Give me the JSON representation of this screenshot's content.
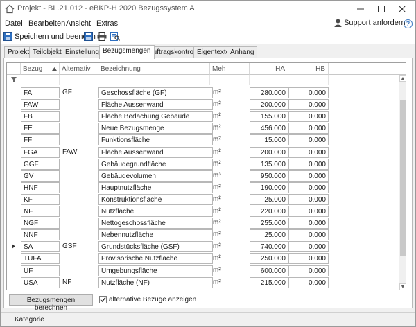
{
  "window": {
    "title": "Projekt - BL.21.012 - eBKP-H 2020 Bezugssystem A"
  },
  "menu": {
    "items": [
      "Datei",
      "Bearbeiten",
      "Ansicht",
      "Extras"
    ],
    "support_label": "Support anfordern"
  },
  "toolbar": {
    "save_close_label": "Speichern und beenden"
  },
  "tabs": [
    "Projekt",
    "Teilobjekte",
    "Einstellungen",
    "Bezugsmengen",
    "Auftragskontrolle",
    "Eigentexte",
    "Anhang"
  ],
  "active_tab": "Bezugsmengen",
  "grid": {
    "columns": [
      "Bezug",
      "Alternativ",
      "Bezeichnung",
      "Meh",
      "HA",
      "HB"
    ],
    "sorted_column": "Bezug",
    "rows": [
      {
        "bezug": "FA",
        "alternativ": "GF",
        "bezeichnung": "Geschossfläche (GF)",
        "meh": "m²",
        "ha": "280.000",
        "hb": "0.000"
      },
      {
        "bezug": "FAW",
        "alternativ": "",
        "bezeichnung": "Fläche Aussenwand",
        "meh": "m²",
        "ha": "200.000",
        "hb": "0.000"
      },
      {
        "bezug": "FB",
        "alternativ": "",
        "bezeichnung": "Fläche Bedachung Gebäude",
        "meh": "m²",
        "ha": "155.000",
        "hb": "0.000"
      },
      {
        "bezug": "FE",
        "alternativ": "",
        "bezeichnung": "Neue Bezugsmenge",
        "meh": "m²",
        "ha": "456.000",
        "hb": "0.000"
      },
      {
        "bezug": "FF",
        "alternativ": "",
        "bezeichnung": "Funktionsfläche",
        "meh": "m²",
        "ha": "15.000",
        "hb": "0.000"
      },
      {
        "bezug": "FGA",
        "alternativ": "FAW",
        "bezeichnung": "Fläche Aussenwand",
        "meh": "m²",
        "ha": "200.000",
        "hb": "0.000"
      },
      {
        "bezug": "GGF",
        "alternativ": "",
        "bezeichnung": "Gebäudegrundfläche",
        "meh": "m²",
        "ha": "135.000",
        "hb": "0.000"
      },
      {
        "bezug": "GV",
        "alternativ": "",
        "bezeichnung": "Gebäudevolumen",
        "meh": "m³",
        "ha": "950.000",
        "hb": "0.000"
      },
      {
        "bezug": "HNF",
        "alternativ": "",
        "bezeichnung": "Hauptnutzfläche",
        "meh": "m²",
        "ha": "190.000",
        "hb": "0.000"
      },
      {
        "bezug": "KF",
        "alternativ": "",
        "bezeichnung": "Konstruktionsfläche",
        "meh": "m²",
        "ha": "25.000",
        "hb": "0.000"
      },
      {
        "bezug": "NF",
        "alternativ": "",
        "bezeichnung": "Nutzfläche",
        "meh": "m²",
        "ha": "220.000",
        "hb": "0.000"
      },
      {
        "bezug": "NGF",
        "alternativ": "",
        "bezeichnung": "Nettogeschossfläche",
        "meh": "m²",
        "ha": "255.000",
        "hb": "0.000"
      },
      {
        "bezug": "NNF",
        "alternativ": "",
        "bezeichnung": "Nebennutzfläche",
        "meh": "m²",
        "ha": "25.000",
        "hb": "0.000"
      },
      {
        "bezug": "SA",
        "alternativ": "GSF",
        "bezeichnung": "Grundstücksfläche (GSF)",
        "meh": "m²",
        "ha": "740.000",
        "hb": "0.000",
        "current": true
      },
      {
        "bezug": "TUFA",
        "alternativ": "",
        "bezeichnung": "Provisorische Nutzfläche",
        "meh": "m²",
        "ha": "250.000",
        "hb": "0.000"
      },
      {
        "bezug": "UF",
        "alternativ": "",
        "bezeichnung": "Umgebungsfläche",
        "meh": "m²",
        "ha": "600.000",
        "hb": "0.000"
      },
      {
        "bezug": "USA",
        "alternativ": "NF",
        "bezeichnung": "Nutzfläche (NF)",
        "meh": "m²",
        "ha": "215.000",
        "hb": "0.000"
      }
    ]
  },
  "buttons": {
    "calculate_label": "Bezugsmengen berechnen"
  },
  "checkbox": {
    "label": "alternative Bezüge anzeigen",
    "checked": true
  },
  "status": {
    "label": "Kategorie"
  }
}
